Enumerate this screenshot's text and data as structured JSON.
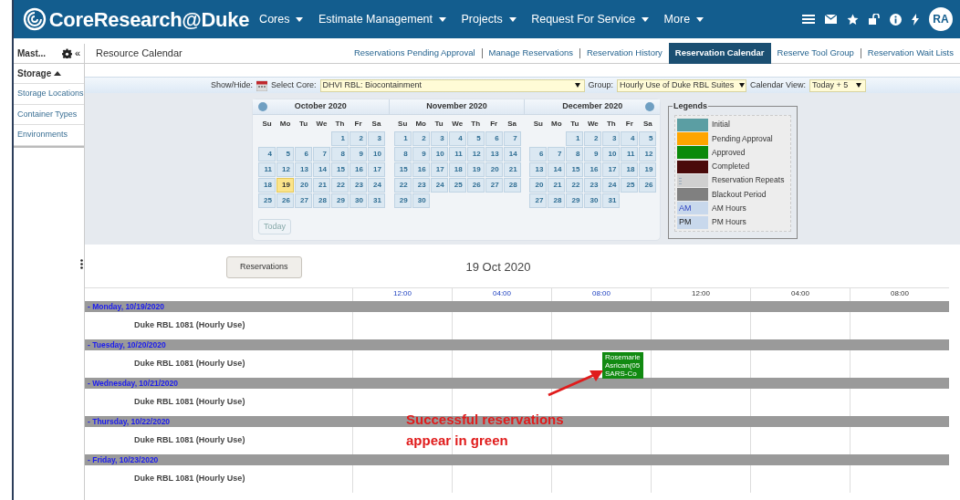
{
  "header": {
    "logo": "**Core**Research@Duke",
    "menus": [
      {
        "label": "Cores"
      },
      {
        "label": "Estimate Management"
      },
      {
        "label": "Projects"
      },
      {
        "label": "Request For Service"
      },
      {
        "label": "More"
      }
    ],
    "avatar": "RA"
  },
  "sidebar": {
    "title": "Mast...",
    "collapse": "«",
    "section": {
      "label": "Storage",
      "expanded": true,
      "items": [
        "Storage Locations",
        "Container Types",
        "Environments"
      ]
    }
  },
  "page_title": "Resource Calendar",
  "tabs": [
    {
      "label": "Reservations Pending Approval",
      "selected": false
    },
    {
      "label": "Manage Reservations",
      "selected": false
    },
    {
      "label": "Reservation History",
      "selected": false
    },
    {
      "label": "Reservation Calendar",
      "selected": true
    },
    {
      "label": "Reserve Tool Group",
      "selected": false
    },
    {
      "label": "Reservation Wait Lists",
      "selected": false
    }
  ],
  "filters": {
    "show_hide_label": "Show/Hide:",
    "core_label": "Select Core:",
    "core_value": "DHVI RBL: Biocontainment",
    "group_label": "Group:",
    "group_value": "Hourly Use of Duke RBL Suites",
    "view_label": "Calendar View:",
    "view_value": "Today + 5"
  },
  "calendar": {
    "today_button": "Today",
    "months": [
      {
        "title": "October 2020",
        "weekdays": [
          "Su",
          "Mo",
          "Tu",
          "We",
          "Th",
          "Fr",
          "Sa"
        ],
        "weeks": [
          [
            {
              "day": "1",
              "selected": false
            },
            {
              "day": "2",
              "selected": false
            },
            {
              "day": "3",
              "selected": false
            }
          ],
          [
            {
              "day": "4",
              "selected": false
            },
            {
              "day": "5",
              "selected": false
            },
            {
              "day": "6",
              "selected": false
            },
            {
              "day": "7",
              "selected": false
            },
            {
              "day": "8",
              "selected": false
            },
            {
              "day": "9",
              "selected": false
            },
            {
              "day": "10",
              "selected": false
            }
          ],
          [
            {
              "day": "11",
              "selected": false
            },
            {
              "day": "12",
              "selected": false
            },
            {
              "day": "13",
              "selected": false
            },
            {
              "day": "14",
              "selected": false
            },
            {
              "day": "15",
              "selected": false
            },
            {
              "day": "16",
              "selected": false
            },
            {
              "day": "17",
              "selected": false
            }
          ],
          [
            {
              "day": "18",
              "selected": false
            },
            {
              "day": "19",
              "selected": true
            },
            {
              "day": "20",
              "selected": false
            },
            {
              "day": "21",
              "selected": false
            },
            {
              "day": "22",
              "selected": false
            },
            {
              "day": "23",
              "selected": false
            },
            {
              "day": "24",
              "selected": false
            }
          ],
          [
            {
              "day": "25",
              "selected": false
            },
            {
              "day": "26",
              "selected": false
            },
            {
              "day": "27",
              "selected": false
            },
            {
              "day": "28",
              "selected": false
            },
            {
              "day": "29",
              "selected": false
            },
            {
              "day": "30",
              "selected": false
            },
            {
              "day": "31",
              "selected": false
            }
          ]
        ]
      },
      {
        "title": "November 2020",
        "weekdays": [
          "Su",
          "Mo",
          "Tu",
          "We",
          "Th",
          "Fr",
          "Sa"
        ],
        "weeks": [
          [
            {
              "day": "1",
              "selected": false
            },
            {
              "day": "2",
              "selected": false
            },
            {
              "day": "3",
              "selected": false
            },
            {
              "day": "4",
              "selected": false
            },
            {
              "day": "5",
              "selected": false
            },
            {
              "day": "6",
              "selected": false
            },
            {
              "day": "7",
              "selected": false
            }
          ],
          [
            {
              "day": "8",
              "selected": false
            },
            {
              "day": "9",
              "selected": false
            },
            {
              "day": "10",
              "selected": false
            },
            {
              "day": "11",
              "selected": false
            },
            {
              "day": "12",
              "selected": false
            },
            {
              "day": "13",
              "selected": false
            },
            {
              "day": "14",
              "selected": false
            }
          ],
          [
            {
              "day": "15",
              "selected": false
            },
            {
              "day": "16",
              "selected": false
            },
            {
              "day": "17",
              "selected": false
            },
            {
              "day": "18",
              "selected": false
            },
            {
              "day": "19",
              "selected": false
            },
            {
              "day": "20",
              "selected": false
            },
            {
              "day": "21",
              "selected": false
            }
          ],
          [
            {
              "day": "22",
              "selected": false
            },
            {
              "day": "23",
              "selected": false
            },
            {
              "day": "24",
              "selected": false
            },
            {
              "day": "25",
              "selected": false
            },
            {
              "day": "26",
              "selected": false
            },
            {
              "day": "27",
              "selected": false
            },
            {
              "day": "28",
              "selected": false
            }
          ],
          [
            {
              "day": "29",
              "selected": false
            },
            {
              "day": "30",
              "selected": false
            }
          ]
        ]
      },
      {
        "title": "December 2020",
        "weekdays": [
          "Su",
          "Mo",
          "Tu",
          "We",
          "Th",
          "Fr",
          "Sa"
        ],
        "weeks": [
          [
            {
              "day": "1",
              "selected": false
            },
            {
              "day": "2",
              "selected": false
            },
            {
              "day": "3",
              "selected": false
            },
            {
              "day": "4",
              "selected": false
            },
            {
              "day": "5",
              "selected": false
            }
          ],
          [
            {
              "day": "6",
              "selected": false
            },
            {
              "day": "7",
              "selected": false
            },
            {
              "day": "8",
              "selected": false
            },
            {
              "day": "9",
              "selected": false
            },
            {
              "day": "10",
              "selected": false
            },
            {
              "day": "11",
              "selected": false
            },
            {
              "day": "12",
              "selected": false
            }
          ],
          [
            {
              "day": "13",
              "selected": false
            },
            {
              "day": "14",
              "selected": false
            },
            {
              "day": "15",
              "selected": false
            },
            {
              "day": "16",
              "selected": false
            },
            {
              "day": "17",
              "selected": false
            },
            {
              "day": "18",
              "selected": false
            },
            {
              "day": "19",
              "selected": false
            }
          ],
          [
            {
              "day": "20",
              "selected": false
            },
            {
              "day": "21",
              "selected": false
            },
            {
              "day": "22",
              "selected": false
            },
            {
              "day": "23",
              "selected": false
            },
            {
              "day": "24",
              "selected": false
            },
            {
              "day": "25",
              "selected": false
            },
            {
              "day": "26",
              "selected": false
            }
          ],
          [
            {
              "day": "27",
              "selected": false
            },
            {
              "day": "28",
              "selected": false
            },
            {
              "day": "29",
              "selected": false
            },
            {
              "day": "30",
              "selected": false
            },
            {
              "day": "31",
              "selected": false
            }
          ]
        ]
      }
    ]
  },
  "legends": {
    "title": "Legends",
    "items": [
      {
        "kind": "swatch",
        "label": "Initial",
        "color": "#5b9ea3"
      },
      {
        "kind": "swatch",
        "label": "Pending Approval",
        "color": "#ffa500"
      },
      {
        "kind": "swatch",
        "label": "Approved",
        "color": "#0b8a0b"
      },
      {
        "kind": "swatch",
        "label": "Completed",
        "color": "#4a0a0a"
      },
      {
        "kind": "repeat",
        "label": "Reservation Repeats",
        "color": "#d0d0d0"
      },
      {
        "kind": "swatch",
        "label": "Blackout Period",
        "color": "#808080"
      },
      {
        "kind": "text",
        "label": "AM Hours",
        "swatch_text": "AM"
      },
      {
        "kind": "text",
        "label": "PM Hours",
        "swatch_text": "PM"
      }
    ]
  },
  "timeline": {
    "button": "Reservations",
    "date": "19 Oct 2020",
    "columns": [
      {
        "label": "12:00",
        "kind": "am"
      },
      {
        "label": "04:00",
        "kind": "am"
      },
      {
        "label": "08:00",
        "kind": "am"
      },
      {
        "label": "12:00",
        "kind": "pm"
      },
      {
        "label": "04:00",
        "kind": "pm"
      },
      {
        "label": "08:00",
        "kind": "pm"
      }
    ],
    "days": [
      {
        "label": "- Monday, 10/19/2020",
        "rows": [
          {
            "resource": "Duke RBL 1081 (Hourly Use)",
            "reservations": []
          }
        ]
      },
      {
        "label": "- Tuesday, 10/20/2020",
        "rows": [
          {
            "resource": "Duke RBL 1081 (Hourly Use)",
            "reservations": [
              {
                "color": "#118a11",
                "lines": [
                  "Rosemarie",
                  "Asrican(05",
                  "SARS-Co"
                ]
              }
            ]
          }
        ]
      },
      {
        "label": "- Wednesday, 10/21/2020",
        "rows": [
          {
            "resource": "Duke RBL 1081 (Hourly Use)",
            "reservations": []
          }
        ]
      },
      {
        "label": "- Thursday, 10/22/2020",
        "rows": [
          {
            "resource": "Duke RBL 1081 (Hourly Use)",
            "reservations": []
          }
        ]
      },
      {
        "label": "- Friday, 10/23/2020",
        "rows": [
          {
            "resource": "Duke RBL 1081 (Hourly Use)",
            "reservations": []
          }
        ]
      }
    ]
  },
  "annotation": {
    "text": "Successful reservations appear in green"
  }
}
